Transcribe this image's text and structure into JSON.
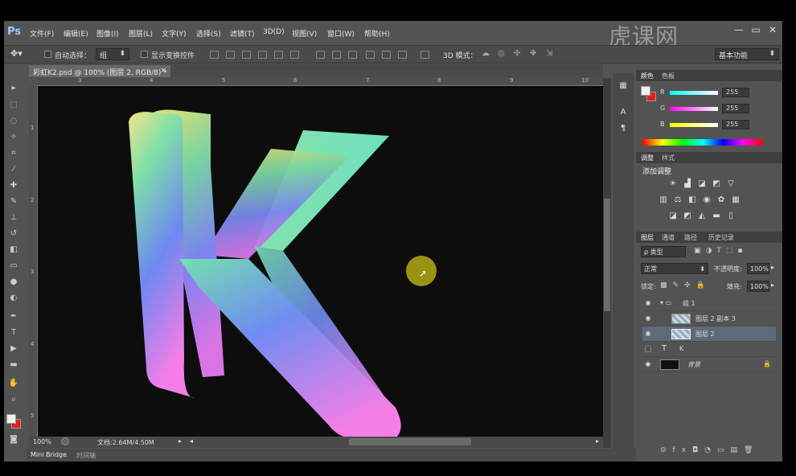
{
  "app": {
    "logo": "Ps",
    "menus": [
      "文件(F)",
      "编辑(E)",
      "图像(I)",
      "图层(L)",
      "文字(Y)",
      "选择(S)",
      "滤镜(T)",
      "3D(D)",
      "视图(V)",
      "窗口(W)",
      "帮助(H)"
    ],
    "brand_watermark": "虎课网",
    "window_buttons": [
      "—",
      "▭",
      "✕"
    ]
  },
  "options_bar": {
    "auto_select_label": "自动选择：",
    "auto_select_value": "组",
    "show_transform_label": "显示变换控件",
    "mode_3d_label": "3D 模式：",
    "workspace": "基本功能"
  },
  "document": {
    "tab_title": "彩虹K2.psd @ 100% (图层 2, RGB/8) *",
    "tab_close": "×",
    "ruler_h": [
      "3",
      "4",
      "5",
      "6",
      "7",
      "8",
      "9",
      "10"
    ],
    "ruler_v": [
      "1",
      "2",
      "3",
      "4",
      "5"
    ],
    "zoom": "100%",
    "doc_size": "文档:2.64M/4.50M"
  },
  "bottom_tabs": [
    "Mini Bridge",
    "时间轴"
  ],
  "color_panel": {
    "tabs": [
      "颜色",
      "色板"
    ],
    "rows": [
      {
        "label": "R",
        "value": "255",
        "color": "#e03030"
      },
      {
        "label": "G",
        "value": "255",
        "color": "#40c040"
      },
      {
        "label": "B",
        "value": "255",
        "color": "#4060e0"
      }
    ],
    "foreground": "#f0f0f0",
    "background": "#e02020"
  },
  "adjust_panel": {
    "tabs": [
      "调整",
      "样式"
    ],
    "title": "添加调整"
  },
  "layers_panel": {
    "tabs": [
      "图层",
      "通道",
      "路径",
      "历史记录"
    ],
    "filter_label": "ρ 类型",
    "blend_mode": "正常",
    "opacity_label": "不透明度:",
    "opacity_value": "100%",
    "lock_label": "锁定:",
    "fill_label": "填充:",
    "fill_value": "100%",
    "layers": [
      {
        "name": "组 1",
        "type": "group"
      },
      {
        "name": "图层 2 副本 3",
        "type": "pixel"
      },
      {
        "name": "图层 2",
        "type": "pixel",
        "selected": true
      },
      {
        "name": "K",
        "type": "text"
      },
      {
        "name": "背景",
        "type": "background"
      }
    ]
  }
}
